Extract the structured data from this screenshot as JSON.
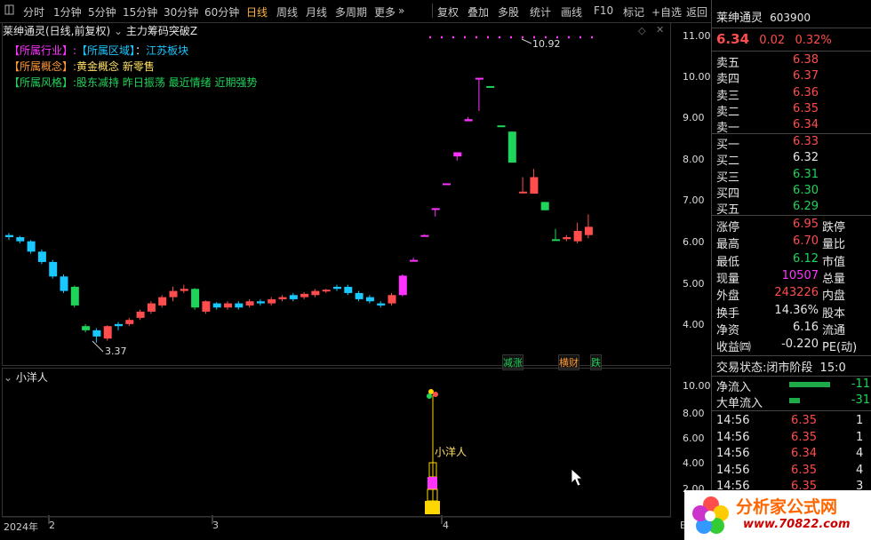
{
  "toolbar": {
    "icon": "square-icon",
    "tabs": [
      "分时",
      "1分钟",
      "5分钟",
      "15分钟",
      "30分钟",
      "60分钟",
      "日线",
      "周线",
      "月线",
      "多周期",
      "更多"
    ],
    "more_arrow": "»",
    "buttons": [
      "复权",
      "叠加",
      "多股",
      "统计",
      "画线",
      "F10",
      "标记",
      "+自选",
      "返回"
    ]
  },
  "chart": {
    "header": "莱绅通灵(日线,前复权)",
    "indicator": "主力筹码突破Z",
    "info_lines": [
      {
        "prefix": "【所属行业】:",
        "label": "【所属区域】",
        "sep": "：",
        "value": "江苏板块"
      },
      {
        "prefix": "【所属概念】:",
        "value": "黄金概念 新零售"
      },
      {
        "prefix": "【所属风格】:",
        "value": "股东减持 昨日振荡 最近情绪 近期强势"
      }
    ],
    "high_label": "10.92",
    "low_label": "3.37",
    "markers": [
      "减涨",
      "横财",
      "跌"
    ],
    "y_ticks": [
      "11.00",
      "10.00",
      "9.00",
      "8.00",
      "7.00",
      "6.00",
      "5.00",
      "4.00"
    ],
    "x_labels": [
      "2024年",
      "2",
      "3",
      "4"
    ],
    "x_end": "E"
  },
  "sub": {
    "title": "小洋人",
    "signal_label": "小洋人",
    "y_ticks": [
      "10.00",
      "8.00",
      "6.00",
      "4.00",
      "2.00"
    ]
  },
  "quote": {
    "name": "莱绅通灵",
    "code": "603900",
    "price": "6.34",
    "change": "0.02",
    "pct": "0.32%",
    "asks": [
      {
        "l": "卖五",
        "v": "6.38"
      },
      {
        "l": "卖四",
        "v": "6.37"
      },
      {
        "l": "卖三",
        "v": "6.36"
      },
      {
        "l": "卖二",
        "v": "6.35"
      },
      {
        "l": "卖一",
        "v": "6.34"
      }
    ],
    "bids": [
      {
        "l": "买一",
        "v": "6.33"
      },
      {
        "l": "买二",
        "v": "6.32"
      },
      {
        "l": "买三",
        "v": "6.31"
      },
      {
        "l": "买四",
        "v": "6.30"
      },
      {
        "l": "买五",
        "v": "6.29"
      }
    ],
    "stats": [
      {
        "l": "涨停",
        "v": "6.95",
        "r": "跌停"
      },
      {
        "l": "最高",
        "v": "6.70",
        "r": "量比"
      },
      {
        "l": "最低",
        "v": "6.12",
        "r": "市值"
      },
      {
        "l": "现量",
        "v": "10507",
        "r": "总量"
      },
      {
        "l": "外盘",
        "v": "243226",
        "r": "内盘"
      },
      {
        "l": "换手",
        "v": "14.36%",
        "r": "股本"
      },
      {
        "l": "净资",
        "v": "6.16",
        "r": "流通"
      },
      {
        "l": "收益㈣",
        "v": "-0.220",
        "r": "PE(动)"
      }
    ],
    "trade_state": "交易状态:",
    "trade_value": "闭市阶段",
    "trade_time": "15:0",
    "net_flow": "净流入",
    "net_flow_val": "-11",
    "big_flow": "大单流入",
    "big_flow_val": "-31",
    "ticks": [
      {
        "t": "14:56",
        "p": "6.35",
        "v": "1"
      },
      {
        "t": "14:56",
        "p": "6.35",
        "v": "1"
      },
      {
        "t": "14:56",
        "p": "6.34",
        "v": "4"
      },
      {
        "t": "14:56",
        "p": "6.35",
        "v": "4"
      },
      {
        "t": "14:56",
        "p": "6.35",
        "v": "3"
      }
    ]
  },
  "watermark": {
    "name": "分析家公式网",
    "url": "www.70822.com"
  },
  "colors": {
    "up": "#ff4d4d",
    "down": "#1fd45a",
    "mag": "#ff33ff",
    "cyan": "#19c8ff"
  }
}
